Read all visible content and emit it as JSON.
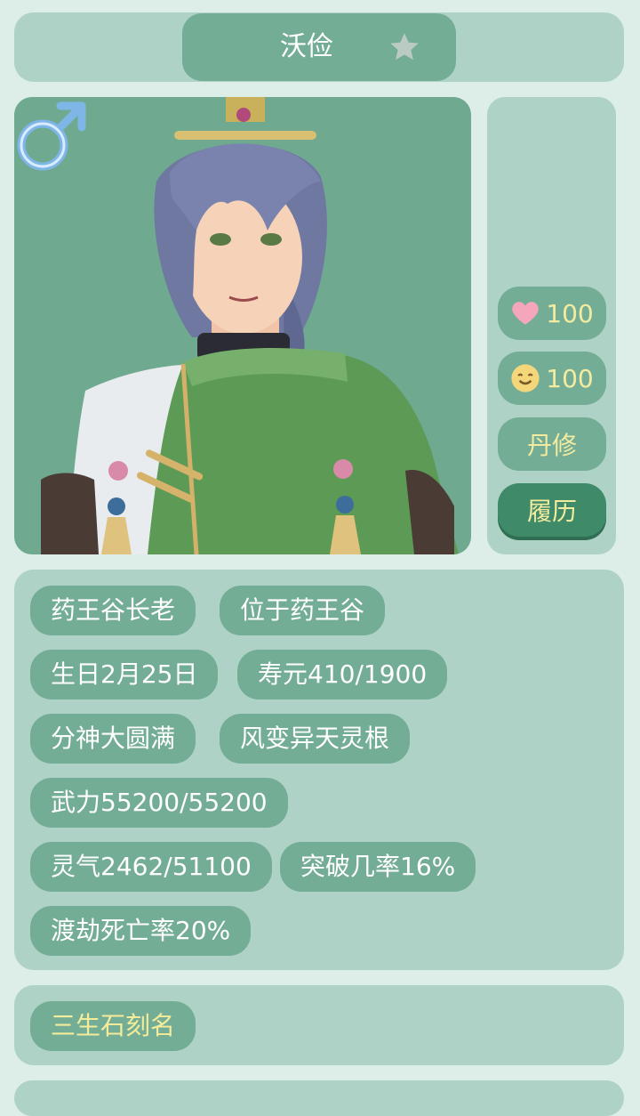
{
  "header": {
    "name": "沃俭",
    "favorite_icon": "star-icon"
  },
  "portrait": {
    "gender_icon": "male-symbol-icon"
  },
  "side_stats": {
    "affection": {
      "icon": "heart-icon",
      "value": "100"
    },
    "mood": {
      "icon": "smile-face-icon",
      "value": "100"
    },
    "profession_label": "丹修",
    "history_label": "履历"
  },
  "info_tags": [
    "药王谷长老",
    "位于药王谷",
    "生日2月25日",
    "寿元410/1900",
    "分神大圆满",
    "风变异天灵根",
    "武力55200/55200",
    "灵气2462/51100",
    "突破几率16%",
    "渡劫死亡率20%"
  ],
  "name_panel": {
    "tag": "三生石刻名"
  },
  "colors": {
    "background": "#ddeee8",
    "panel": "#aed2c5",
    "pill": "#74ad96",
    "accent_dark": "#3f8a68",
    "highlight_text": "#f2eba0"
  }
}
